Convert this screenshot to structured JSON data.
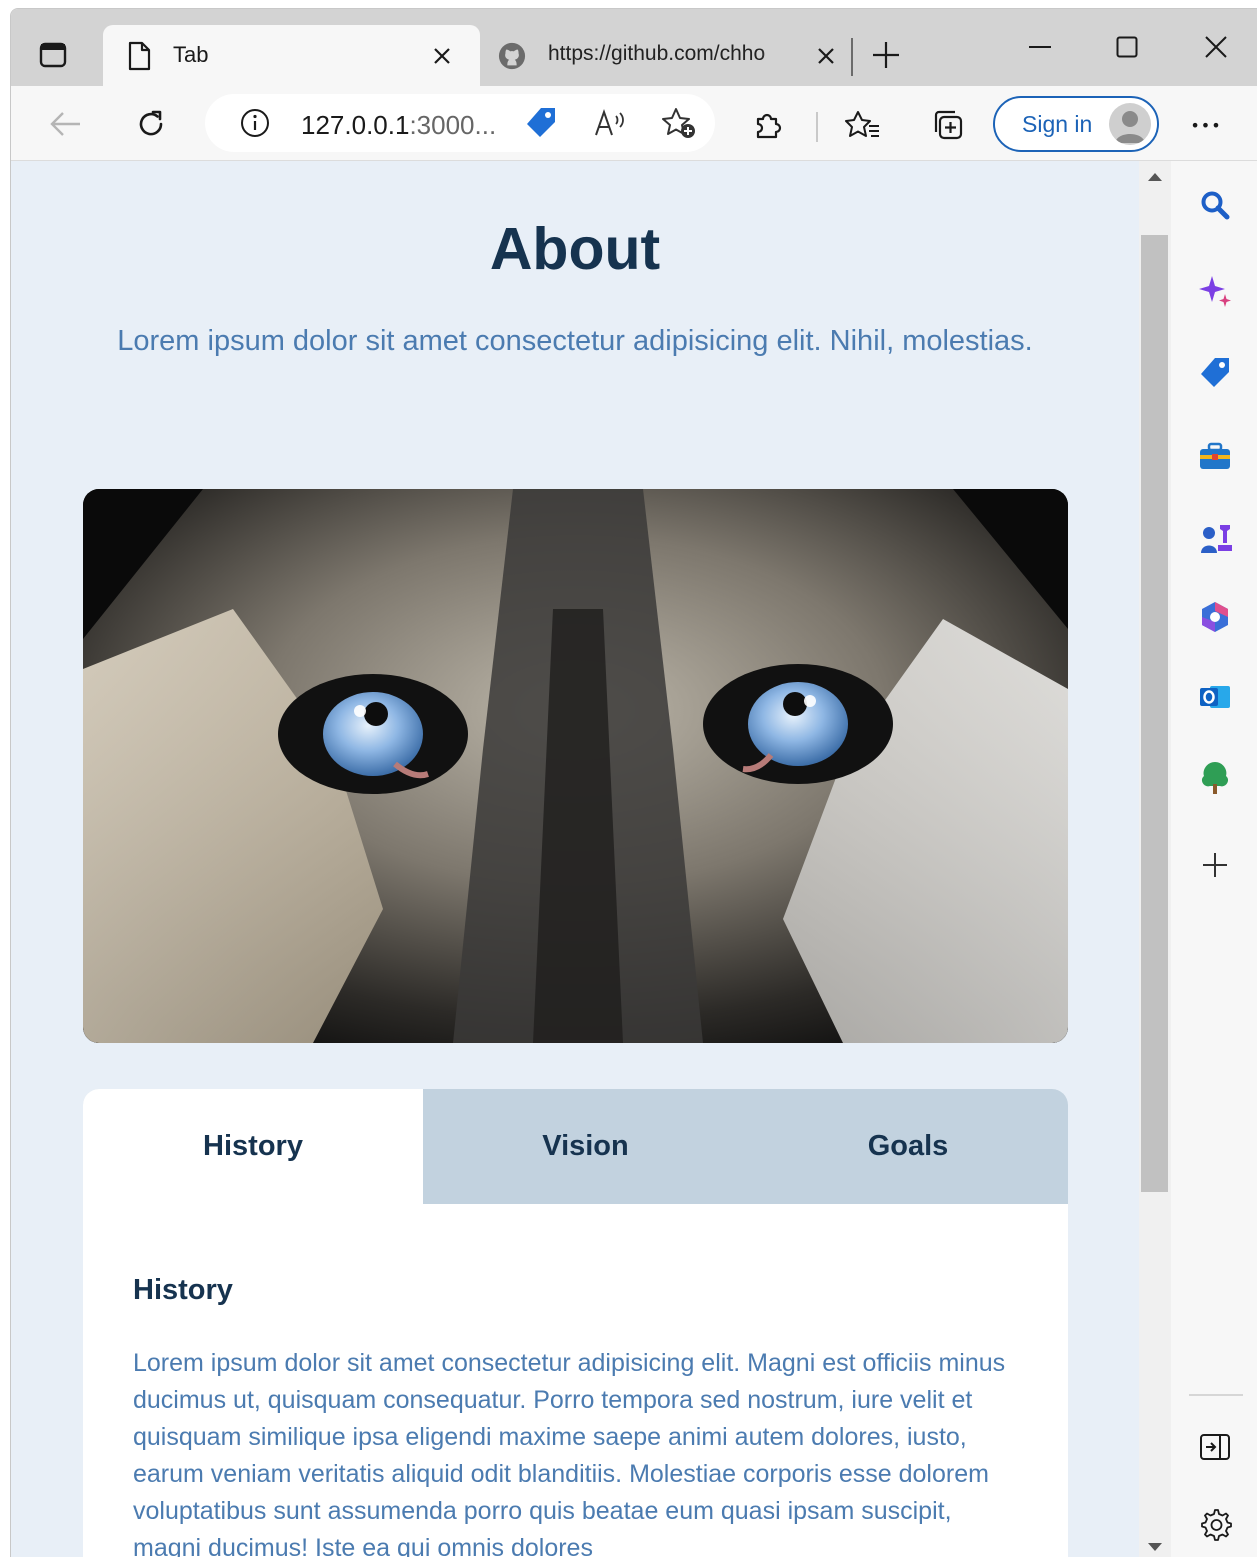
{
  "browser": {
    "tabs": [
      {
        "title": "Tab",
        "active": true,
        "favicon": "page-icon"
      },
      {
        "title": "https://github.com/chho",
        "active": false,
        "favicon": "github-icon"
      }
    ],
    "address": {
      "host": "127.0.0.1",
      "rest": ":3000..."
    },
    "sign_in_label": "Sign in",
    "more_label": "•••",
    "sidebar_icons": [
      "search-icon",
      "copilot-icon",
      "shopping-tag-icon",
      "tools-icon",
      "games-icon",
      "microsoft-365-icon",
      "outlook-icon",
      "tree-icon",
      "add-icon",
      "hide-sidebar-icon",
      "settings-icon"
    ]
  },
  "page": {
    "title": "About",
    "subtitle": "Lorem ipsum dolor sit amet consectetur adipisicing elit. Nihil, molestias.",
    "hero_alt": "Close-up of a husky's blue eyes",
    "tabs": [
      {
        "label": "History",
        "active": true
      },
      {
        "label": "Vision",
        "active": false
      },
      {
        "label": "Goals",
        "active": false
      }
    ],
    "panel": {
      "heading": "History",
      "text": "Lorem ipsum dolor sit amet consectetur adipisicing elit. Magni est officiis minus ducimus ut, quisquam consequatur. Porro tempora sed nostrum, iure velit et quisquam similique ipsa eligendi maxime saepe animi autem dolores, iusto, earum veniam veritatis aliquid odit blanditiis. Molestiae corporis esse dolorem voluptatibus sunt assumenda porro quis beatae eum quasi ipsam suscipit, magni ducimus! Iste ea qui omnis dolores"
    }
  },
  "colors": {
    "page_bg": "#e8eff7",
    "heading": "#16334f",
    "body_text": "#4b7bb0",
    "tab_inactive_bg": "#c2d2df",
    "accent": "#1c63b7"
  }
}
